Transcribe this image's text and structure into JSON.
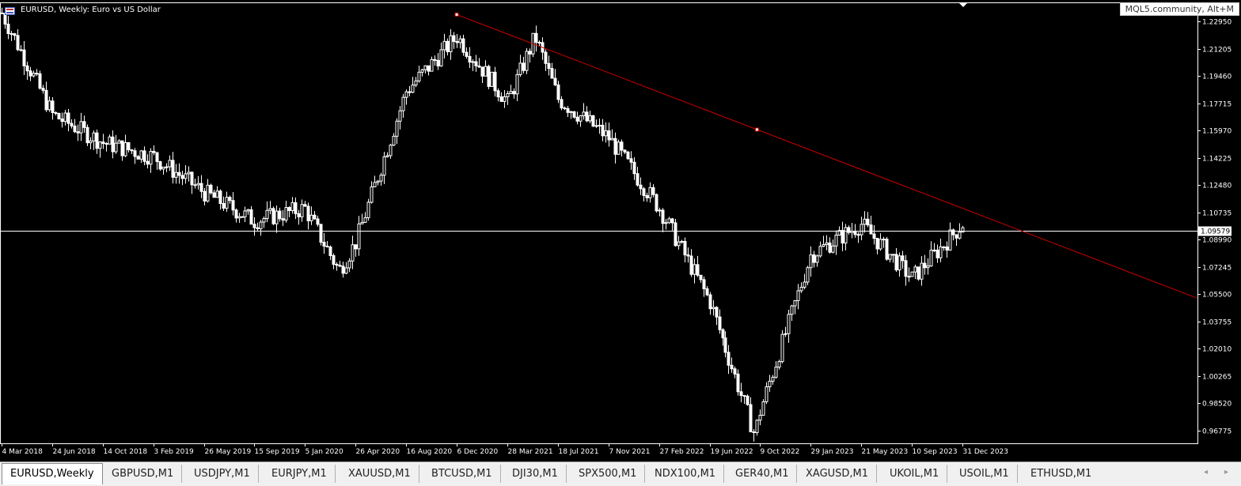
{
  "window": {
    "title": "EURUSD, Weekly:  Euro vs US Dollar",
    "community_badge": "MQL5.community, Alt+M"
  },
  "tabs": [
    {
      "label": "EURUSD,Weekly",
      "active": true
    },
    {
      "label": "GBPUSD,M1"
    },
    {
      "label": "USDJPY,M1"
    },
    {
      "label": "EURJPY,M1"
    },
    {
      "label": "XAUUSD,M1"
    },
    {
      "label": "BTCUSD,M1"
    },
    {
      "label": "DJI30,M1"
    },
    {
      "label": "SPX500,M1"
    },
    {
      "label": "NDX100,M1"
    },
    {
      "label": "GER40,M1"
    },
    {
      "label": "XAGUSD,M1"
    },
    {
      "label": "UKOIL,M1"
    },
    {
      "label": "USOIL,M1"
    },
    {
      "label": "ETHUSD,M1"
    }
  ],
  "scroll": {
    "left_icon": "arrow-left-icon",
    "right_icon": "arrow-right-icon",
    "left": "◂",
    "right": "▸"
  },
  "chart_data": {
    "type": "candlestick",
    "symbol": "EURUSD",
    "timeframe": "Weekly",
    "colors": {
      "background": "#000000",
      "bull": "#ffffff",
      "bear": "#ffffff",
      "trendline": "#cc0000",
      "price_line": "#ffffff"
    },
    "current_price": "1.09579",
    "ylim": [
      0.95935,
      1.24
    ],
    "y_ticks": [
      "1.22950",
      "1.21205",
      "1.19460",
      "1.17715",
      "1.15970",
      "1.14225",
      "1.12480",
      "1.10735",
      "1.08990",
      "1.07245",
      "1.05500",
      "1.03755",
      "1.02010",
      "1.00265",
      "0.98520",
      "0.96775"
    ],
    "x_ticks": [
      "4 Mar 2018",
      "24 Jun 2018",
      "14 Oct 2018",
      "3 Feb 2019",
      "26 May 2019",
      "15 Sep 2019",
      "5 Jan 2020",
      "26 Apr 2020",
      "16 Aug 2020",
      "6 Dec 2020",
      "28 Mar 2021",
      "18 Jul 2021",
      "7 Nov 2021",
      "27 Feb 2022",
      "19 Jun 2022",
      "9 Oct 2022",
      "29 Jan 2023",
      "21 May 2023",
      "10 Sep 2023",
      "31 Dec 2023"
    ],
    "x_range": [
      "4 Mar 2018",
      "31 Dec 2023"
    ],
    "close_path": [
      {
        "date": "4 Mar 2018",
        "close": 1.235
      },
      {
        "date": "24 Jun 2018",
        "close": 1.17
      },
      {
        "date": "14 Oct 2018",
        "close": 1.152
      },
      {
        "date": "3 Feb 2019",
        "close": 1.143
      },
      {
        "date": "26 May 2019",
        "close": 1.12
      },
      {
        "date": "15 Sep 2019",
        "close": 1.102
      },
      {
        "date": "5 Jan 2020",
        "close": 1.11
      },
      {
        "date": "20 Mar 2020",
        "close": 1.07
      },
      {
        "date": "26 Apr 2020",
        "close": 1.088
      },
      {
        "date": "16 Aug 2020",
        "close": 1.185
      },
      {
        "date": "6 Dec 2020",
        "close": 1.22
      },
      {
        "date": "28 Mar 2021",
        "close": 1.178
      },
      {
        "date": "28 May 2021",
        "close": 1.22
      },
      {
        "date": "18 Jul 2021",
        "close": 1.18
      },
      {
        "date": "7 Nov 2021",
        "close": 1.155
      },
      {
        "date": "27 Feb 2022",
        "close": 1.11
      },
      {
        "date": "19 Jun 2022",
        "close": 1.05
      },
      {
        "date": "27 Sep 2022",
        "close": 0.965
      },
      {
        "date": "9 Oct 2022",
        "close": 0.98
      },
      {
        "date": "29 Jan 2023",
        "close": 1.08
      },
      {
        "date": "21 May 2023",
        "close": 1.1
      },
      {
        "date": "10 Sep 2023",
        "close": 1.065
      },
      {
        "date": "31 Dec 2023",
        "close": 1.1
      }
    ],
    "trendline": {
      "from": {
        "date": "6 Dec 2020",
        "price": 1.234
      },
      "to": {
        "date": "31 Dec 2023",
        "price": 1.11
      },
      "extended": true,
      "mid_anchor": {
        "date": "2 Oct 2022",
        "price": 1.1435
      }
    }
  }
}
